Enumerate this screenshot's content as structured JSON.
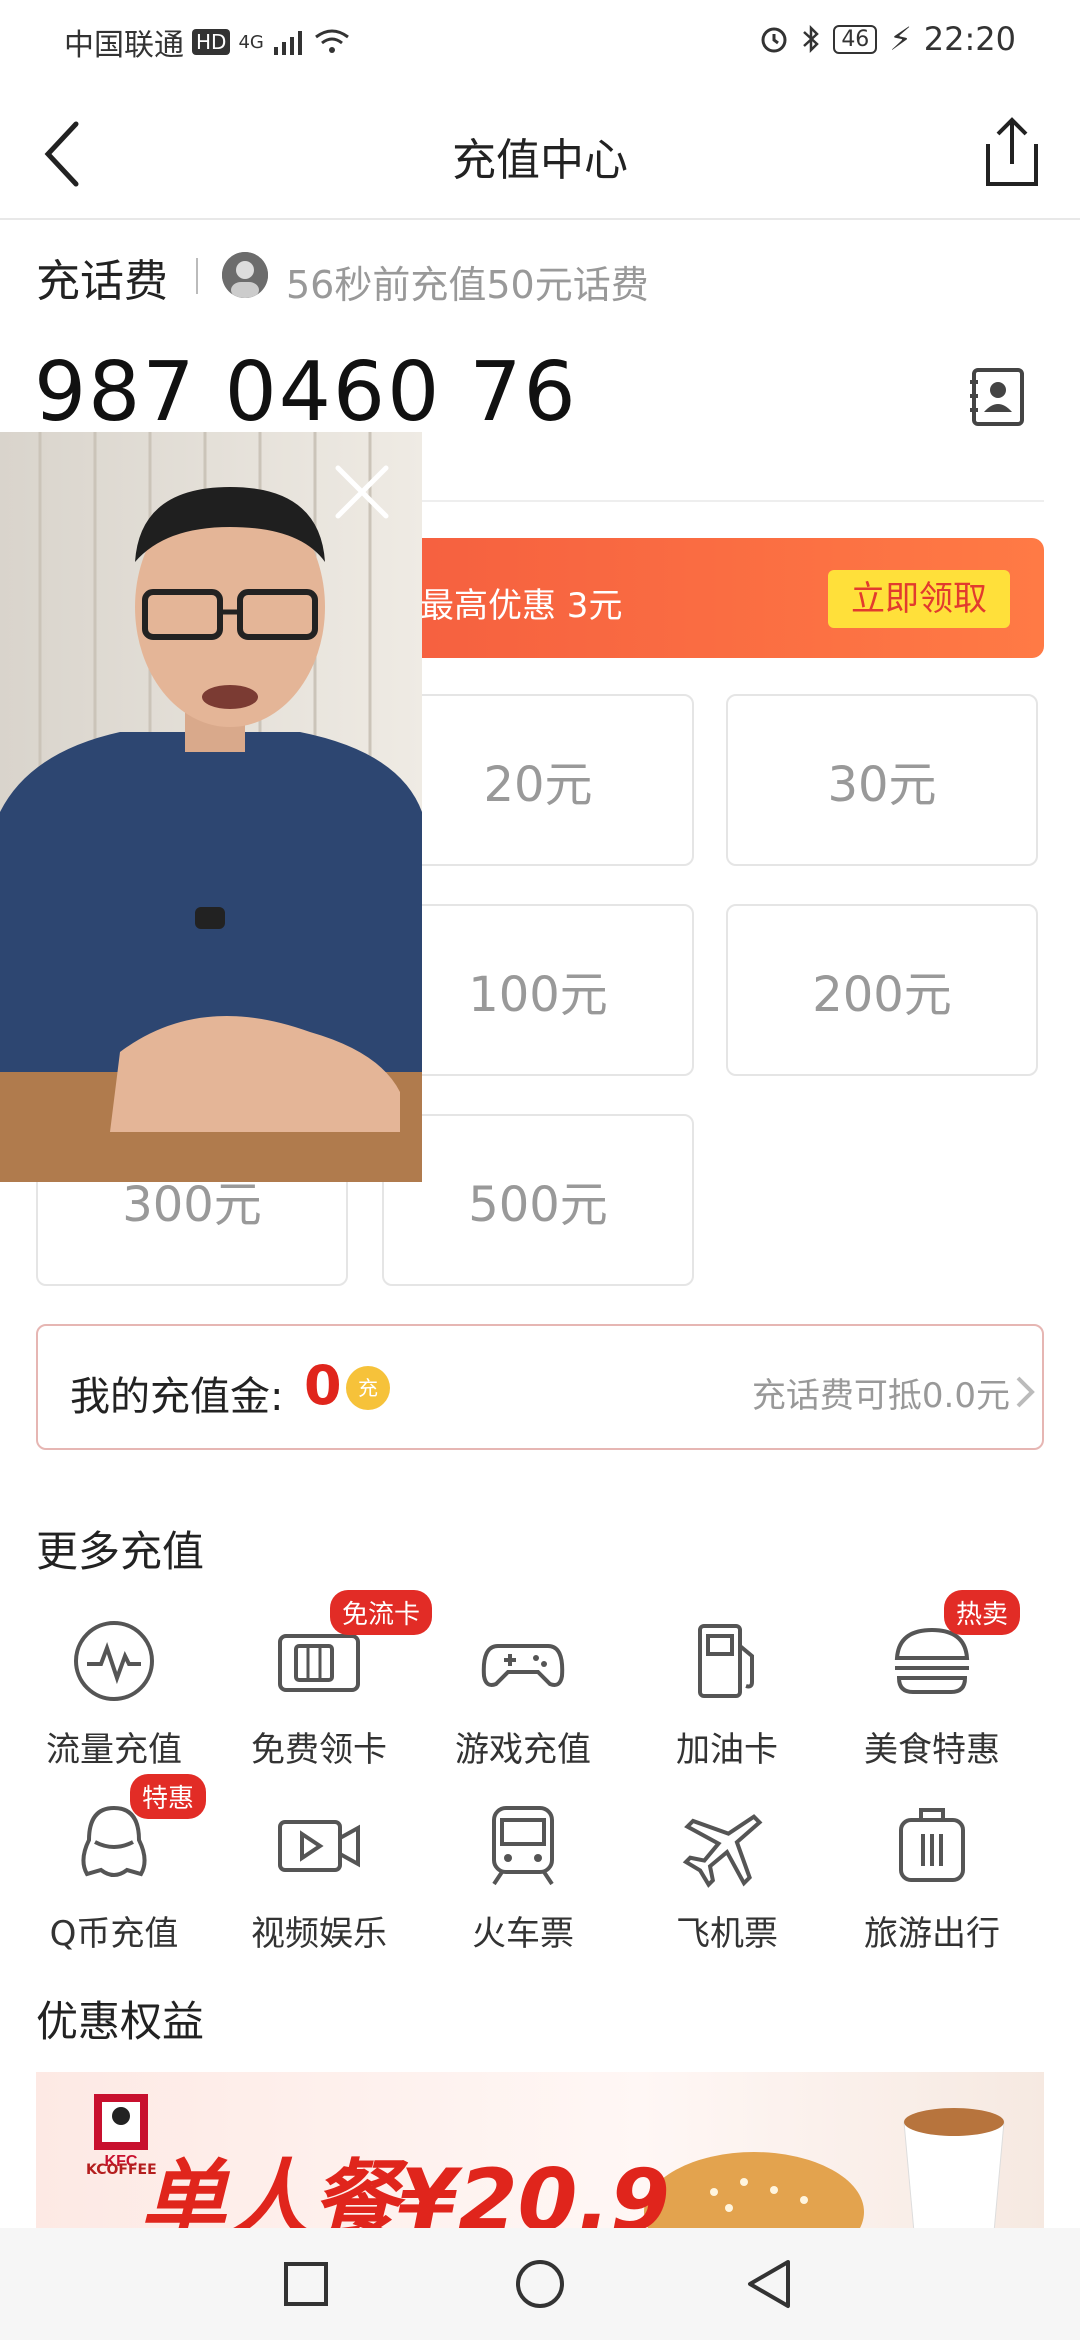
{
  "status_bar": {
    "carrier": "中国联通",
    "hd": "HD",
    "network": "4G",
    "battery": "46",
    "time": "22:20"
  },
  "header": {
    "title": "充值中心"
  },
  "recharge": {
    "label": "充话费",
    "recent_text": "56秒前充值50元话费",
    "phone": "987 0460 76"
  },
  "promo": {
    "text": "最高优惠 3元",
    "button": "立即领取"
  },
  "amounts": {
    "a20": "20元",
    "a30": "30元",
    "a100": "100元",
    "a200": "200元",
    "a300": "300元",
    "a500": "500元"
  },
  "gold": {
    "label": "我的充值金:",
    "value": "0",
    "coin": "充",
    "right": "充话费可抵0.0元"
  },
  "more": {
    "title": "更多充值",
    "items": [
      {
        "label": "流量充值",
        "icon": "pulse-icon"
      },
      {
        "label": "免费领卡",
        "icon": "sim-card-icon",
        "badge": "免流卡"
      },
      {
        "label": "游戏充值",
        "icon": "gamepad-icon"
      },
      {
        "label": "加油卡",
        "icon": "fuel-pump-icon"
      },
      {
        "label": "美食特惠",
        "icon": "burger-icon",
        "badge": "热卖"
      },
      {
        "label": "Q币充值",
        "icon": "penguin-icon",
        "badge": "特惠"
      },
      {
        "label": "视频娱乐",
        "icon": "video-icon"
      },
      {
        "label": "火车票",
        "icon": "train-icon"
      },
      {
        "label": "飞机票",
        "icon": "plane-icon"
      },
      {
        "label": "旅游出行",
        "icon": "suitcase-icon"
      }
    ]
  },
  "benefits": {
    "title": "优惠权益",
    "banner_price": "单人餐¥20.9",
    "kfc_brand": "KFC",
    "kfc_sub": "KCOFFEE"
  },
  "colors": {
    "accent": "#e0251c",
    "promo_start": "#f0513c",
    "promo_end": "#ff7a45",
    "promo_button": "#ffe03a"
  }
}
